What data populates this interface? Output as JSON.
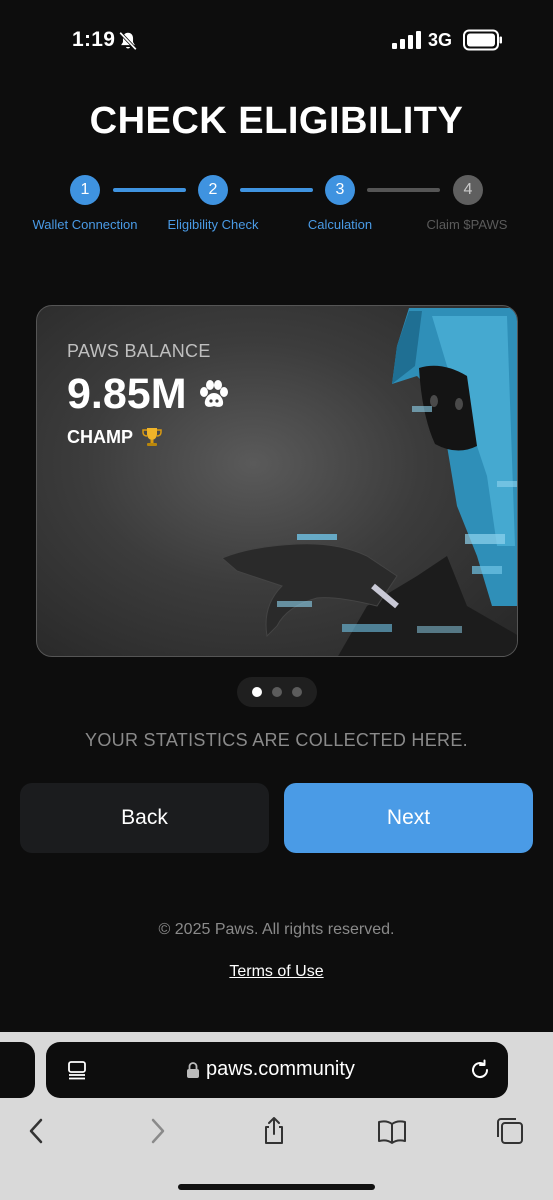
{
  "status_bar": {
    "time": "1:19",
    "network": "3G",
    "icons": [
      "bell-slash-icon",
      "signal-icon",
      "battery-icon"
    ]
  },
  "page_title": "CHECK ELIGIBILITY",
  "stepper": {
    "steps": [
      {
        "number": "1",
        "label": "Wallet Connection",
        "state": "active"
      },
      {
        "number": "2",
        "label": "Eligibility Check",
        "state": "active"
      },
      {
        "number": "3",
        "label": "Calculation",
        "state": "active"
      },
      {
        "number": "4",
        "label": "Claim $PAWS",
        "state": "inactive"
      }
    ],
    "colors": {
      "active": "#3f93e0",
      "inactive": "#5f5f5f"
    }
  },
  "card": {
    "label": "PAWS BALANCE",
    "value": "9.85M",
    "rank": "CHAMP",
    "icons": [
      "paw-icon",
      "trophy-icon"
    ]
  },
  "carousel": {
    "total": 3,
    "active_index": 0
  },
  "stats_caption": "YOUR STATISTICS ARE COLLECTED HERE.",
  "buttons": {
    "back": "Back",
    "next": "Next",
    "accent": "#4a9be6"
  },
  "footer": {
    "copyright": "© 2025 Paws. All rights reserved.",
    "terms": "Terms of Use"
  },
  "browser": {
    "url": "paws.community",
    "icons": [
      "page-menu-icon",
      "lock-icon",
      "reload-icon",
      "back-icon",
      "forward-icon",
      "share-icon",
      "bookmarks-icon",
      "tabs-icon"
    ]
  }
}
